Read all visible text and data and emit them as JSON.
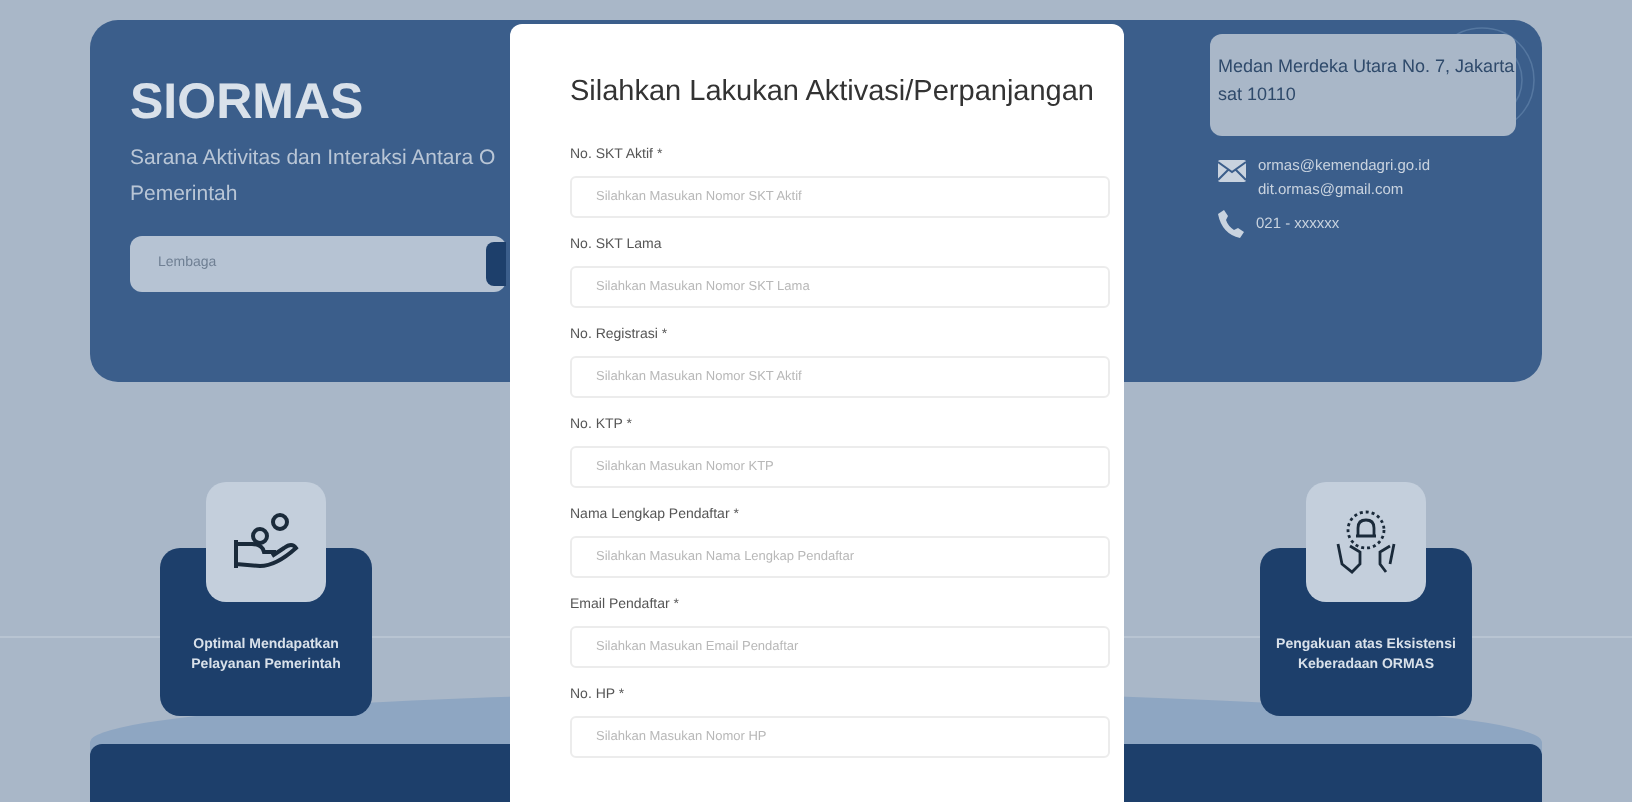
{
  "hero": {
    "title": "SIORMAS",
    "subtitle_lines": [
      "Sarana Aktivitas dan Interaksi Antara O",
      "Pemerintah"
    ],
    "search": {
      "placeholder": "Lembaga"
    }
  },
  "contact": {
    "address_lines": [
      "Medan Merdeka Utara No. 7, Jakarta",
      "sat 10110"
    ],
    "emails": [
      "ormas@kemendagri.go.id",
      "dit.ormas@gmail.com"
    ],
    "phone": "021 - xxxxxx"
  },
  "features": [
    {
      "kind": "hand",
      "label": "Optimal Mendapatkan Pelayanan Pemerintah"
    },
    {
      "kind": "bell",
      "label": "Pengakuan atas Eksistensi Keberadaan ORMAS"
    }
  ],
  "modal": {
    "title": "Silahkan Lakukan Aktivasi/Perpanjangan",
    "fields": [
      {
        "label": "No. SKT Aktif *",
        "placeholder": "Silahkan Masukan Nomor SKT Aktif"
      },
      {
        "label": "No. SKT Lama",
        "placeholder": "Silahkan Masukan Nomor SKT Lama"
      },
      {
        "label": "No. Registrasi *",
        "placeholder": "Silahkan Masukan Nomor SKT Aktif"
      },
      {
        "label": "No. KTP *",
        "placeholder": "Silahkan Masukan Nomor KTP"
      },
      {
        "label": "Nama Lengkap Pendaftar *",
        "placeholder": "Silahkan Masukan Nama Lengkap Pendaftar"
      },
      {
        "label": "Email Pendaftar *",
        "placeholder": "Silahkan Masukan Email Pendaftar"
      },
      {
        "label": "No. HP *",
        "placeholder": "Silahkan Masukan Nomor HP"
      }
    ]
  }
}
